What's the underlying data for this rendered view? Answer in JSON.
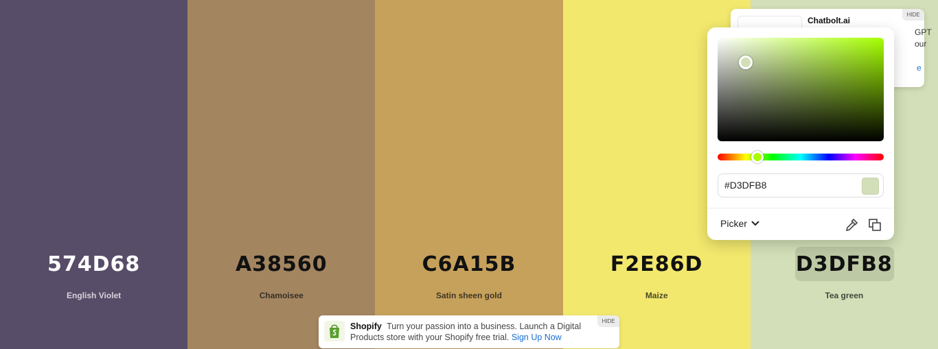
{
  "palette": {
    "colors": [
      {
        "hex": "574D68",
        "name": "English Violet",
        "bg": "#574D68",
        "text": "#ffffff"
      },
      {
        "hex": "A38560",
        "name": "Chamoisee",
        "bg": "#A38560",
        "text": "#111111"
      },
      {
        "hex": "C6A15B",
        "name": "Satin sheen gold",
        "bg": "#C6A15B",
        "text": "#111111"
      },
      {
        "hex": "F2E86D",
        "name": "Maize",
        "bg": "#F2E86D",
        "text": "#111111"
      },
      {
        "hex": "D3DFB8",
        "name": "Tea green",
        "bg": "#D3DFB8",
        "text": "#111111"
      }
    ]
  },
  "ad_top": {
    "title": "Chatbolt.ai",
    "frag1": "GPT",
    "frag2": "our",
    "frag3": "e",
    "hide": "HIDE"
  },
  "picker": {
    "hex_value": "#D3DFB8",
    "hue_color": "#A6FF00",
    "mode_label": "Picker",
    "icons": [
      "chevron-down-icon",
      "eyedropper-icon",
      "copy-icon"
    ]
  },
  "ad_bottom": {
    "brand": "Shopify",
    "text": "Turn your passion into a business. Launch a Digital Products store with your Shopify free trial.",
    "cta": "Sign Up Now",
    "hide": "HIDE"
  }
}
